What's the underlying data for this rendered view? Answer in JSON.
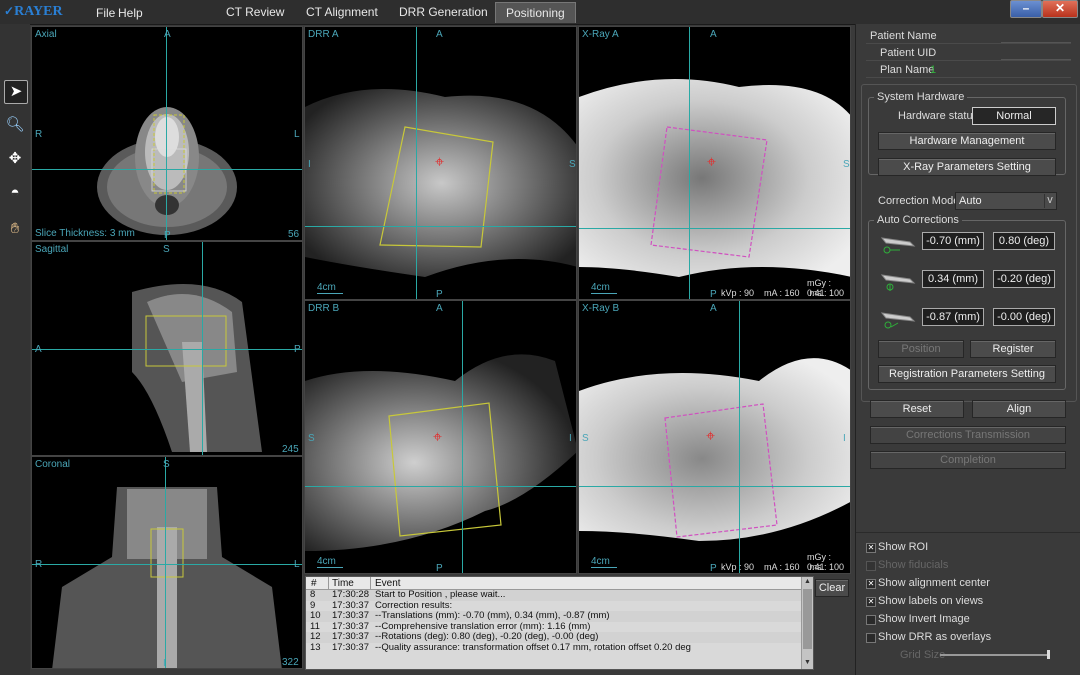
{
  "app": {
    "logo": "RAYER"
  },
  "menu": {
    "file": "File",
    "help": "Help"
  },
  "tabs": [
    {
      "label": "CT Review",
      "active": false
    },
    {
      "label": "CT Alignment",
      "active": false
    },
    {
      "label": "DRR Generation",
      "active": false
    },
    {
      "label": "Positioning",
      "active": true
    }
  ],
  "window_controls": {
    "minimize": "–",
    "close": "✕"
  },
  "views": {
    "axial": {
      "label": "Axial",
      "number": "56",
      "slice_info": "Slice Thickness: 3 mm",
      "top": "A",
      "bottom": "P",
      "left": "R",
      "right": "L"
    },
    "sagittal": {
      "label": "Sagittal",
      "number": "245",
      "top": "S",
      "left": "A",
      "right": "P"
    },
    "coronal": {
      "label": "Coronal",
      "number": "322",
      "top": "S",
      "left": "R",
      "right": "L",
      "bottom": "I"
    },
    "drr_a": {
      "label": "DRR A",
      "top": "A",
      "bottom": "P",
      "left": "I",
      "right": "S",
      "scale": "4cm"
    },
    "xray_a": {
      "label": "X-Ray A",
      "top": "A",
      "bottom": "P",
      "right": "S",
      "scale": "4cm",
      "mgy": "mGy : 0.41",
      "params": "kVp : 90    mA : 160    ms : 100"
    },
    "drr_b": {
      "label": "DRR B",
      "top": "A",
      "bottom": "P",
      "left": "S",
      "right": "I",
      "scale": "4cm"
    },
    "xray_b": {
      "label": "X-Ray B",
      "top": "A",
      "bottom": "P",
      "left": "S",
      "right": "I",
      "scale": "4cm",
      "mgy": "mGy : 0.41",
      "params": "kVp : 90    mA : 160    ms : 100"
    }
  },
  "patient": {
    "name_label": "Patient Name",
    "name_value": "",
    "uid_label": "Patient UID",
    "uid_value": "",
    "plan_label": "Plan Name",
    "plan_value": "1"
  },
  "system_hardware": {
    "title": "System Hardware",
    "status_label": "Hardware status",
    "status_value": "Normal",
    "management_button": "Hardware Management",
    "xray_params_button": "X-Ray Parameters Setting"
  },
  "correction_mode": {
    "label": "Correction Mode",
    "value": "Auto",
    "arrow": "v"
  },
  "auto_corrections": {
    "title": "Auto Corrections",
    "rows": [
      {
        "mm": "-0.70 (mm)",
        "deg": "0.80 (deg)",
        "axis": "X"
      },
      {
        "mm": "0.34 (mm)",
        "deg": "-0.20 (deg)",
        "axis": "Y"
      },
      {
        "mm": "-0.87 (mm)",
        "deg": "-0.00 (deg)",
        "axis": "Z"
      }
    ],
    "position_button": "Position",
    "register_button": "Register",
    "reg_params_button": "Registration Parameters Setting"
  },
  "actions": {
    "reset": "Reset",
    "align": "Align",
    "corrections_transmission": "Corrections Transmission",
    "completion": "Completion"
  },
  "options": [
    {
      "label": "Show ROI",
      "checked": true,
      "enabled": true
    },
    {
      "label": "Show fiducials",
      "checked": false,
      "enabled": false
    },
    {
      "label": "Show alignment center",
      "checked": true,
      "enabled": true
    },
    {
      "label": "Show labels on views",
      "checked": true,
      "enabled": true
    },
    {
      "label": "Show Invert Image",
      "checked": false,
      "enabled": true
    },
    {
      "label": "Show DRR as overlays",
      "checked": false,
      "enabled": true
    }
  ],
  "grid_size": {
    "label": "Grid Size",
    "value_fraction": 1.0
  },
  "log": {
    "headers": {
      "num": "#",
      "time": "Time",
      "event": "Event"
    },
    "rows": [
      {
        "num": "8",
        "time": "17:30:28",
        "event": "Start to Position , please wait..."
      },
      {
        "num": "9",
        "time": "17:30:37",
        "event": "Correction results:"
      },
      {
        "num": "10",
        "time": "17:30:37",
        "event": "--Translations (mm): -0.70 (mm), 0.34 (mm), -0.87 (mm)"
      },
      {
        "num": "11",
        "time": "17:30:37",
        "event": "--Comprehensive translation error (mm): 1.16 (mm)"
      },
      {
        "num": "12",
        "time": "17:30:37",
        "event": "--Rotations (deg): 0.80 (deg), -0.20 (deg), -0.00 (deg)"
      },
      {
        "num": "13",
        "time": "17:30:37",
        "event": "--Quality assurance: transformation offset 0.17 mm, rotation offset 0.20 deg"
      }
    ],
    "clear_button": "Clear"
  },
  "colors": {
    "crosshair": "#2aa9a5",
    "target": "#e03030",
    "drr_box": "#c8c83a",
    "xray_box": "#d050c0",
    "accent_green": "#2fae3a"
  }
}
